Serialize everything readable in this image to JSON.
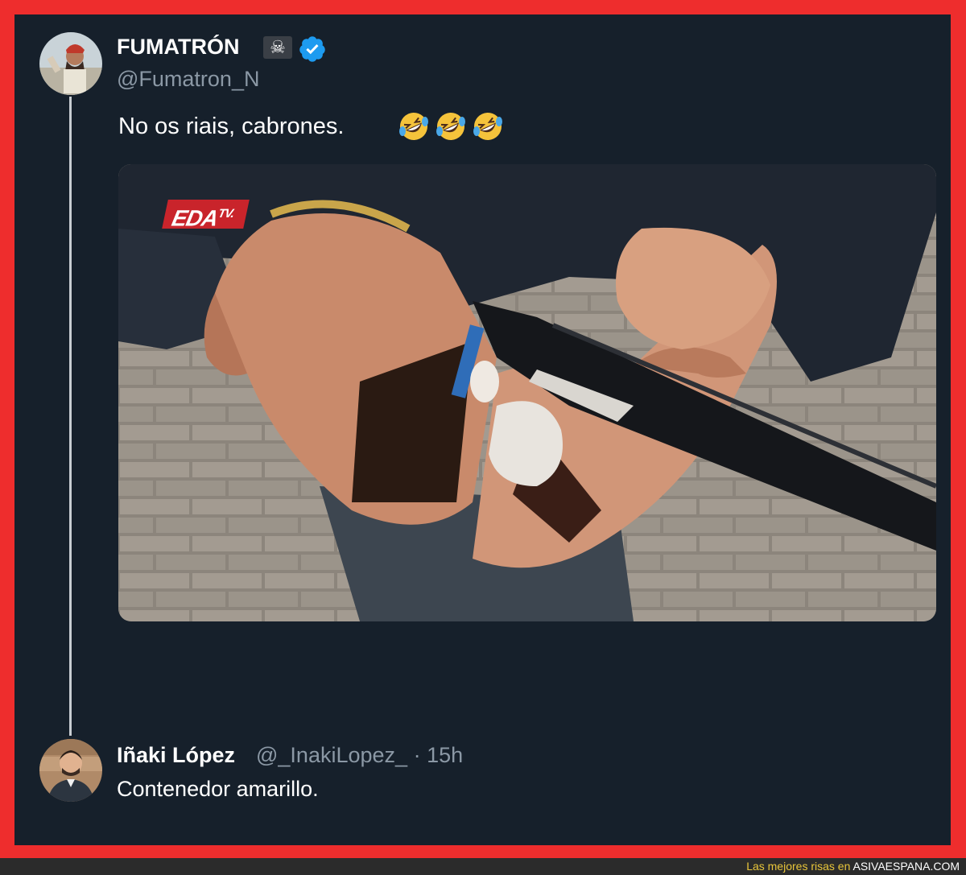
{
  "tweet": {
    "display_name": "FUMATRÓN",
    "name_badge": "☠",
    "handle": "@Fumatron_N",
    "text": "No os riais, cabrones.",
    "emojis": [
      "rolling-on-floor-laughing",
      "rolling-on-floor-laughing",
      "rolling-on-floor-laughing"
    ],
    "media": {
      "logo_main": "EDA",
      "logo_suffix": "TV."
    }
  },
  "reply": {
    "display_name": "Iñaki López",
    "handle": "@_InakiLopez_",
    "separator": "·",
    "time": "15h",
    "text": "Contenedor amarillo."
  },
  "footer": {
    "prefix": "Las mejores risas en",
    "site": "ASIVAESPANA.COM"
  },
  "colors": {
    "frame_red": "#ee2d2d",
    "panel_bg": "#16202b",
    "muted_text": "#8b98a5",
    "verified_blue": "#1d9bf0",
    "footer_accent": "#e8c53a"
  }
}
